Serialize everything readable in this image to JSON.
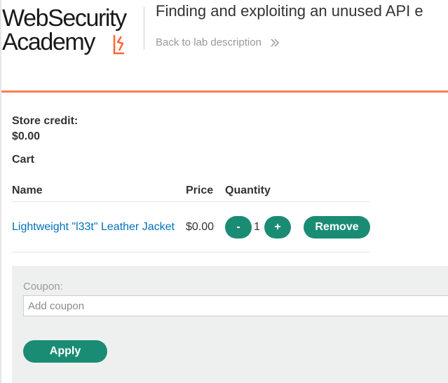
{
  "header": {
    "logo_line1": "WebSecurity",
    "logo_line2": "Academy",
    "lab_title": "Finding and exploiting an unused API e",
    "back_link": "Back to lab description",
    "brand_color": "#ff6633"
  },
  "store": {
    "credit_label": "Store credit:",
    "credit_value": "$0.00"
  },
  "cart": {
    "heading": "Cart",
    "columns": [
      "Name",
      "Price",
      "Quantity"
    ],
    "items": [
      {
        "name": "Lightweight \"l33t\" Leather Jacket",
        "price": "$0.00",
        "decrement_label": "-",
        "quantity": "1",
        "increment_label": "+",
        "remove_label": "Remove"
      }
    ]
  },
  "coupon": {
    "label": "Coupon:",
    "placeholder": "Add coupon",
    "value": "",
    "apply_label": "Apply"
  },
  "colors": {
    "button": "#1a8c74",
    "link": "#0071bc",
    "panel": "#eef0f0"
  }
}
